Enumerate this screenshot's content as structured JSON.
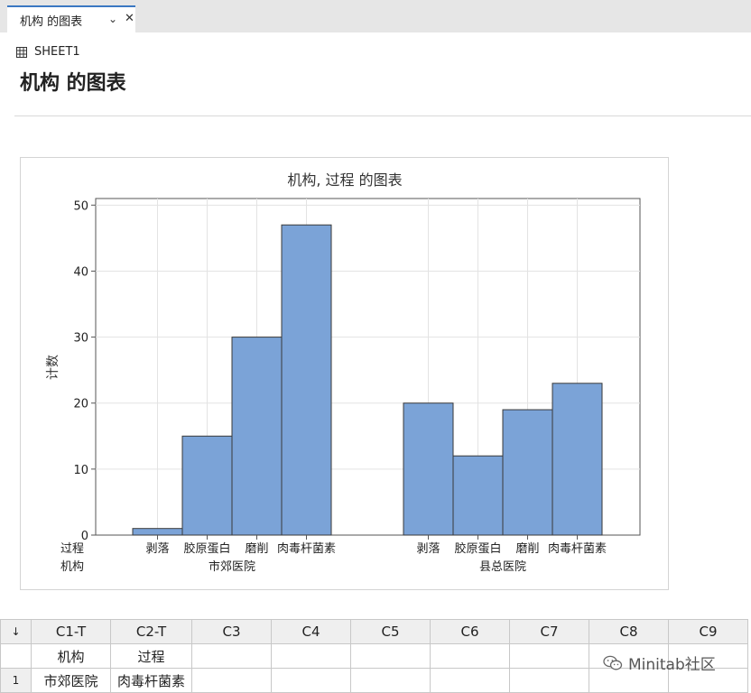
{
  "tab": {
    "label": "机构 的图表",
    "chevron": "⌄",
    "close": "✕"
  },
  "sheet_label": "SHEET1",
  "page_title": "机构 的图表",
  "chart_data": {
    "type": "bar",
    "title": "机构, 过程 的图表",
    "ylabel": "计数",
    "ylim": [
      0,
      50
    ],
    "yticks": [
      0,
      10,
      20,
      30,
      40,
      50
    ],
    "row_labels": [
      "过程",
      "机构"
    ],
    "groups": [
      {
        "name": "市郊医院",
        "categories": [
          "剥落",
          "胶原蛋白",
          "磨削",
          "肉毒杆菌素"
        ],
        "values": [
          1,
          15,
          30,
          47
        ]
      },
      {
        "name": "县总医院",
        "categories": [
          "剥落",
          "胶原蛋白",
          "磨削",
          "肉毒杆菌素"
        ],
        "values": [
          20,
          12,
          19,
          23
        ]
      }
    ],
    "bar_color": "#7ba3d7",
    "grid": true
  },
  "worksheet": {
    "corner": "↓",
    "columns": [
      "C1-T",
      "C2-T",
      "C3",
      "C4",
      "C5",
      "C6",
      "C7",
      "C8",
      "C9"
    ],
    "names": [
      "机构",
      "过程",
      "",
      "",
      "",
      "",
      "",
      "",
      ""
    ],
    "rows": [
      {
        "index": "1",
        "cells": [
          "市郊医院",
          "肉毒杆菌素",
          "",
          "",
          "",
          "",
          "",
          "",
          ""
        ]
      }
    ]
  },
  "watermark": "Minitab社区"
}
